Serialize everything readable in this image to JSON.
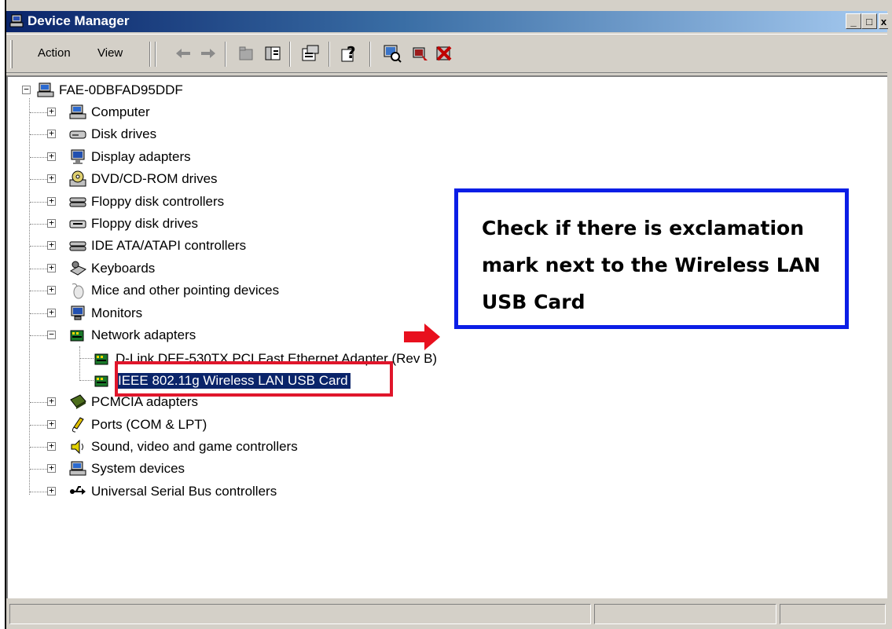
{
  "window": {
    "title": "Device Manager",
    "controls": {
      "minimize": "_",
      "maximize": "□",
      "close": "x"
    }
  },
  "menu": {
    "action": "Action",
    "view": "View"
  },
  "toolbar_icons": [
    "back-icon",
    "forward-icon",
    "up-icon",
    "show-hide-tree-icon",
    "properties-icon",
    "help-icon",
    "scan-hardware-icon",
    "update-driver-icon",
    "uninstall-icon"
  ],
  "tree": {
    "root": "FAE-0DBFAD95DDF",
    "categories": [
      {
        "label": "Computer",
        "icon": "computer-icon"
      },
      {
        "label": "Disk drives",
        "icon": "disk-drive-icon"
      },
      {
        "label": "Display adapters",
        "icon": "display-adapter-icon"
      },
      {
        "label": "DVD/CD-ROM drives",
        "icon": "cdrom-icon"
      },
      {
        "label": "Floppy disk controllers",
        "icon": "controller-icon"
      },
      {
        "label": "Floppy disk drives",
        "icon": "floppy-drive-icon"
      },
      {
        "label": "IDE ATA/ATAPI controllers",
        "icon": "controller-icon"
      },
      {
        "label": "Keyboards",
        "icon": "keyboard-icon"
      },
      {
        "label": "Mice and other pointing devices",
        "icon": "mouse-icon"
      },
      {
        "label": "Monitors",
        "icon": "monitor-icon"
      },
      {
        "label": "Network adapters",
        "icon": "network-adapter-icon",
        "expanded": true
      },
      {
        "label": "PCMCIA adapters",
        "icon": "pcmcia-icon"
      },
      {
        "label": "Ports (COM & LPT)",
        "icon": "port-icon"
      },
      {
        "label": "Sound, video and game controllers",
        "icon": "sound-icon"
      },
      {
        "label": "System devices",
        "icon": "system-icon"
      },
      {
        "label": "Universal Serial Bus controllers",
        "icon": "usb-icon"
      }
    ],
    "network_children": [
      {
        "label": "D-Link DFE-530TX PCI Fast Ethernet Adapter (Rev B)"
      },
      {
        "label": "IEEE 802.11g Wireless LAN USB Card",
        "selected": true
      }
    ]
  },
  "callout": {
    "text": "Check if there is exclamation mark next to the Wireless LAN USB Card"
  },
  "colors": {
    "highlight_box": "#e0162b",
    "callout_border": "#0b1ee6",
    "arrow": "#e8101e",
    "selection": "#0a246a"
  }
}
